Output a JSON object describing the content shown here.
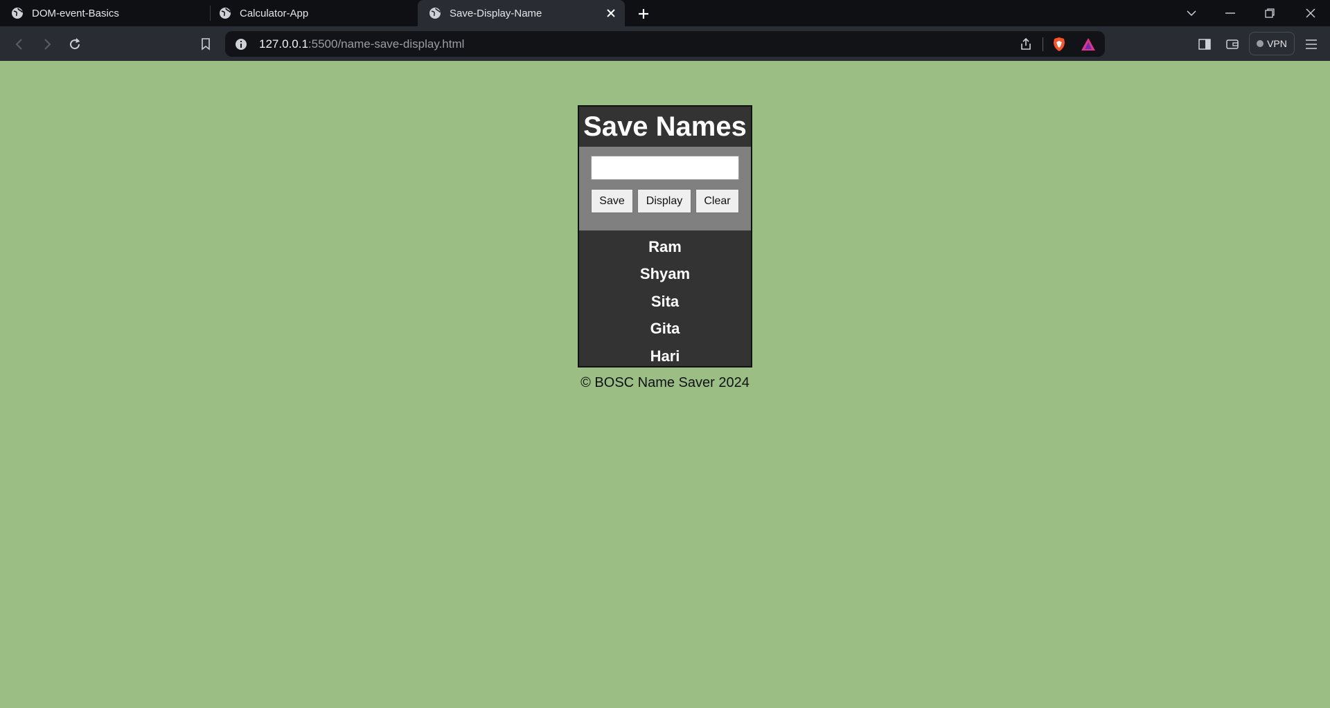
{
  "browser": {
    "tabs": [
      {
        "title": "DOM-event-Basics"
      },
      {
        "title": "Calculator-App"
      },
      {
        "title": "Save-Display-Name"
      }
    ],
    "url_host": "127.0.0.1",
    "url_rest": ":5500/name-save-display.html",
    "vpn_label": "VPN"
  },
  "app": {
    "title": "Save Names",
    "input_value": "",
    "buttons": {
      "save": "Save",
      "display": "Display",
      "clear": "Clear"
    },
    "names": [
      "Ram",
      "Shyam",
      "Sita",
      "Gita",
      "Hari"
    ],
    "footer": "© BOSC Name Saver 2024"
  },
  "colors": {
    "page_bg": "#9abe84",
    "card_bg": "#333333",
    "form_bg": "#808080"
  }
}
